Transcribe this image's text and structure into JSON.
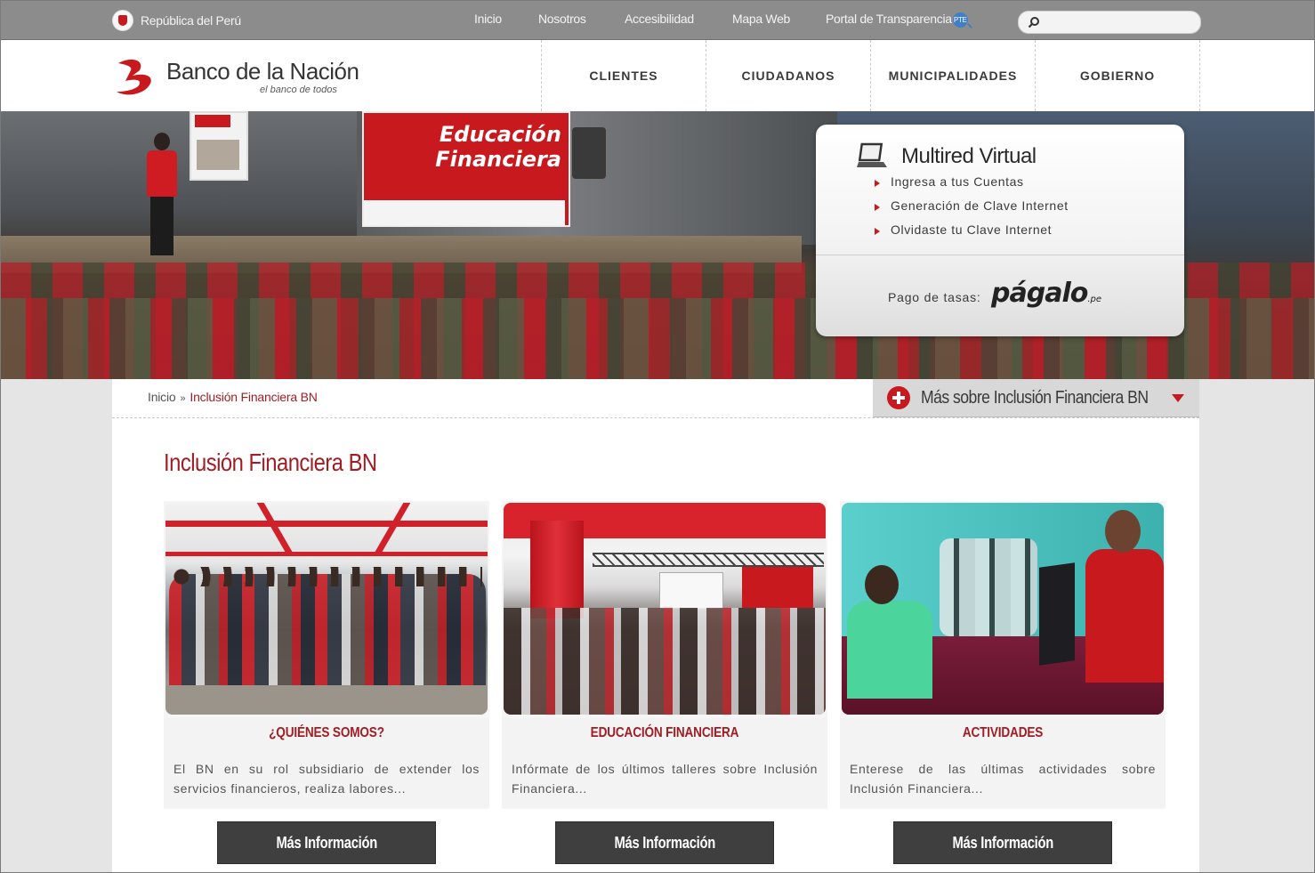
{
  "topbar": {
    "gov_label": "República del Perú",
    "links": [
      "Inicio",
      "Nosotros",
      "Accesibilidad",
      "Mapa Web",
      "Portal de Transparencia"
    ],
    "pte_badge": "PTE",
    "search": {
      "value": "",
      "placeholder": ""
    }
  },
  "header": {
    "logo_name": "Banco de la Nación",
    "logo_tagline": "el banco de todos",
    "nav": [
      "CLIENTES",
      "CIUDADANOS",
      "MUNICIPALIDADES",
      "GOBIERNO"
    ]
  },
  "hero": {
    "banner_text_1": "Educación",
    "banner_text_2": "Financiera",
    "multired": {
      "title": "Multired Virtual",
      "links": [
        "Ingresa a tus Cuentas",
        "Generación de Clave Internet",
        "Olvidaste tu Clave Internet"
      ],
      "pago_label": "Pago de tasas:",
      "pagalo_brand": "págalo",
      "pagalo_suffix": ".pe"
    }
  },
  "breadcrumb": {
    "home": "Inicio",
    "separator": "»",
    "current": "Inclusión Financiera BN"
  },
  "more_dropdown": {
    "label": "Más sobre Inclusión Financiera BN"
  },
  "page": {
    "title": "Inclusión Financiera BN",
    "cards": [
      {
        "title": "¿QUIÉNES SOMOS?",
        "text": "El BN en su rol subsidiario de extender los servicios financieros, realiza labores...",
        "button": "Más Información"
      },
      {
        "title": "EDUCACIÓN FINANCIERA",
        "text": "Infórmate de los últimos talleres sobre Inclusión Financiera...",
        "button": "Más Información"
      },
      {
        "title": "ACTIVIDADES",
        "text": "Enterese de las últimas actividades sobre Inclusión Financiera...",
        "button": "Más Información"
      }
    ]
  },
  "colors": {
    "brand_red": "#c8191e",
    "title_red": "#a11d24",
    "topbar_gray": "#8c8c8c",
    "button_dark": "#3f3f3f"
  },
  "icons": [
    "peru-seal-icon",
    "search-icon",
    "transparency-search-icon",
    "bn-logo-icon",
    "laptop-icon",
    "plus-circle-icon",
    "caret-down-icon"
  ]
}
